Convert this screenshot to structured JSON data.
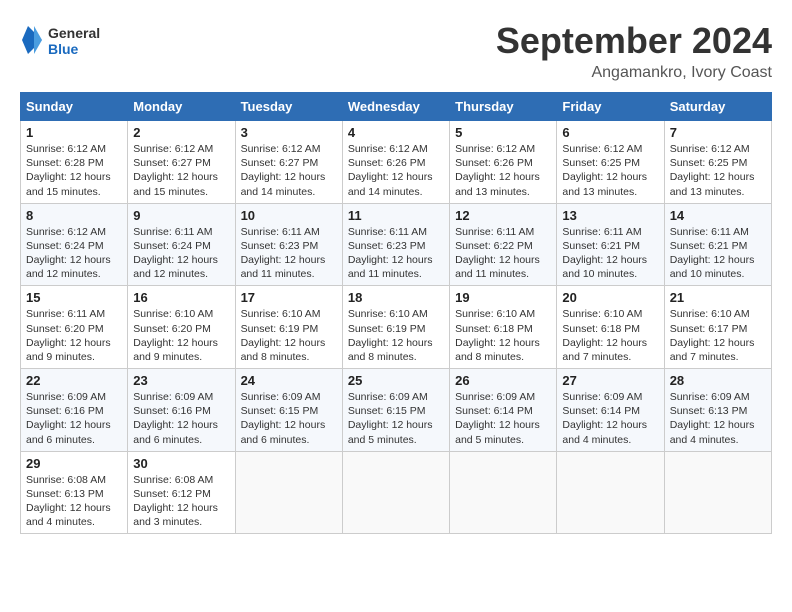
{
  "logo": {
    "text_general": "General",
    "text_blue": "Blue"
  },
  "title": "September 2024",
  "location": "Angamankro, Ivory Coast",
  "days_of_week": [
    "Sunday",
    "Monday",
    "Tuesday",
    "Wednesday",
    "Thursday",
    "Friday",
    "Saturday"
  ],
  "weeks": [
    [
      {
        "day": "1",
        "sunrise": "6:12 AM",
        "sunset": "6:28 PM",
        "daylight": "12 hours and 15 minutes."
      },
      {
        "day": "2",
        "sunrise": "6:12 AM",
        "sunset": "6:27 PM",
        "daylight": "12 hours and 15 minutes."
      },
      {
        "day": "3",
        "sunrise": "6:12 AM",
        "sunset": "6:27 PM",
        "daylight": "12 hours and 14 minutes."
      },
      {
        "day": "4",
        "sunrise": "6:12 AM",
        "sunset": "6:26 PM",
        "daylight": "12 hours and 14 minutes."
      },
      {
        "day": "5",
        "sunrise": "6:12 AM",
        "sunset": "6:26 PM",
        "daylight": "12 hours and 13 minutes."
      },
      {
        "day": "6",
        "sunrise": "6:12 AM",
        "sunset": "6:25 PM",
        "daylight": "12 hours and 13 minutes."
      },
      {
        "day": "7",
        "sunrise": "6:12 AM",
        "sunset": "6:25 PM",
        "daylight": "12 hours and 13 minutes."
      }
    ],
    [
      {
        "day": "8",
        "sunrise": "6:12 AM",
        "sunset": "6:24 PM",
        "daylight": "12 hours and 12 minutes."
      },
      {
        "day": "9",
        "sunrise": "6:11 AM",
        "sunset": "6:24 PM",
        "daylight": "12 hours and 12 minutes."
      },
      {
        "day": "10",
        "sunrise": "6:11 AM",
        "sunset": "6:23 PM",
        "daylight": "12 hours and 11 minutes."
      },
      {
        "day": "11",
        "sunrise": "6:11 AM",
        "sunset": "6:23 PM",
        "daylight": "12 hours and 11 minutes."
      },
      {
        "day": "12",
        "sunrise": "6:11 AM",
        "sunset": "6:22 PM",
        "daylight": "12 hours and 11 minutes."
      },
      {
        "day": "13",
        "sunrise": "6:11 AM",
        "sunset": "6:21 PM",
        "daylight": "12 hours and 10 minutes."
      },
      {
        "day": "14",
        "sunrise": "6:11 AM",
        "sunset": "6:21 PM",
        "daylight": "12 hours and 10 minutes."
      }
    ],
    [
      {
        "day": "15",
        "sunrise": "6:11 AM",
        "sunset": "6:20 PM",
        "daylight": "12 hours and 9 minutes."
      },
      {
        "day": "16",
        "sunrise": "6:10 AM",
        "sunset": "6:20 PM",
        "daylight": "12 hours and 9 minutes."
      },
      {
        "day": "17",
        "sunrise": "6:10 AM",
        "sunset": "6:19 PM",
        "daylight": "12 hours and 8 minutes."
      },
      {
        "day": "18",
        "sunrise": "6:10 AM",
        "sunset": "6:19 PM",
        "daylight": "12 hours and 8 minutes."
      },
      {
        "day": "19",
        "sunrise": "6:10 AM",
        "sunset": "6:18 PM",
        "daylight": "12 hours and 8 minutes."
      },
      {
        "day": "20",
        "sunrise": "6:10 AM",
        "sunset": "6:18 PM",
        "daylight": "12 hours and 7 minutes."
      },
      {
        "day": "21",
        "sunrise": "6:10 AM",
        "sunset": "6:17 PM",
        "daylight": "12 hours and 7 minutes."
      }
    ],
    [
      {
        "day": "22",
        "sunrise": "6:09 AM",
        "sunset": "6:16 PM",
        "daylight": "12 hours and 6 minutes."
      },
      {
        "day": "23",
        "sunrise": "6:09 AM",
        "sunset": "6:16 PM",
        "daylight": "12 hours and 6 minutes."
      },
      {
        "day": "24",
        "sunrise": "6:09 AM",
        "sunset": "6:15 PM",
        "daylight": "12 hours and 6 minutes."
      },
      {
        "day": "25",
        "sunrise": "6:09 AM",
        "sunset": "6:15 PM",
        "daylight": "12 hours and 5 minutes."
      },
      {
        "day": "26",
        "sunrise": "6:09 AM",
        "sunset": "6:14 PM",
        "daylight": "12 hours and 5 minutes."
      },
      {
        "day": "27",
        "sunrise": "6:09 AM",
        "sunset": "6:14 PM",
        "daylight": "12 hours and 4 minutes."
      },
      {
        "day": "28",
        "sunrise": "6:09 AM",
        "sunset": "6:13 PM",
        "daylight": "12 hours and 4 minutes."
      }
    ],
    [
      {
        "day": "29",
        "sunrise": "6:08 AM",
        "sunset": "6:13 PM",
        "daylight": "12 hours and 4 minutes."
      },
      {
        "day": "30",
        "sunrise": "6:08 AM",
        "sunset": "6:12 PM",
        "daylight": "12 hours and 3 minutes."
      },
      null,
      null,
      null,
      null,
      null
    ]
  ]
}
